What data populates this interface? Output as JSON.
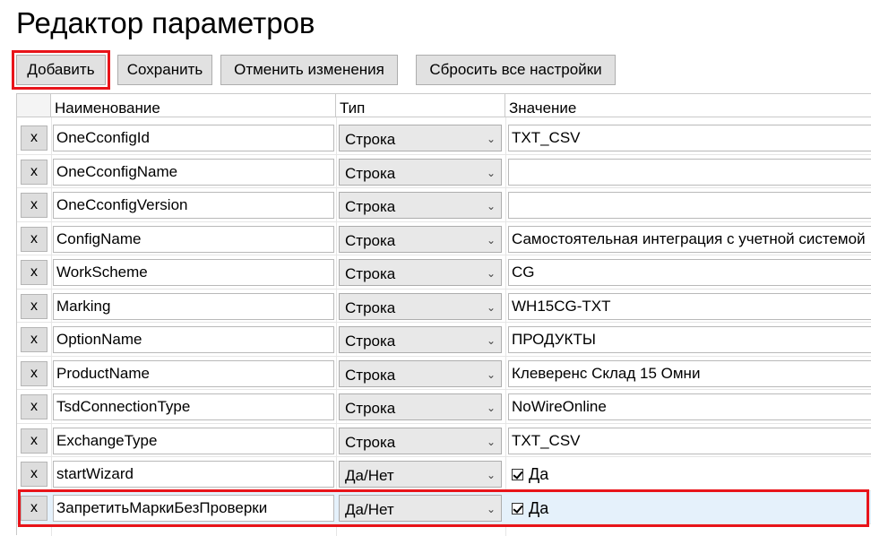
{
  "page": {
    "title": "Редактор параметров"
  },
  "toolbar": {
    "add_label": "Добавить",
    "save_label": "Сохранить",
    "cancel_label": "Отменить изменения",
    "reset_label": "Сбросить все настройки"
  },
  "grid": {
    "columns": [
      "Наименование",
      "Тип",
      "Значение"
    ],
    "delete_label": "x",
    "rows": [
      {
        "name": "OneCconfigId",
        "type": "Строка",
        "value": "TXT_CSV"
      },
      {
        "name": "OneCconfigName",
        "type": "Строка",
        "value": ""
      },
      {
        "name": "OneCconfigVersion",
        "type": "Строка",
        "value": ""
      },
      {
        "name": "ConfigName",
        "type": "Строка",
        "value": "Самостоятельная интеграция с учетной системой"
      },
      {
        "name": "WorkScheme",
        "type": "Строка",
        "value": "CG"
      },
      {
        "name": "Marking",
        "type": "Строка",
        "value": "WH15CG-TXT"
      },
      {
        "name": "OptionName",
        "type": "Строка",
        "value": "ПРОДУКТЫ"
      },
      {
        "name": "ProductName",
        "type": "Строка",
        "value": "Клеверенс Склад 15 Омни"
      },
      {
        "name": "TsdConnectionType",
        "type": "Строка",
        "value": "NoWireOnline"
      },
      {
        "name": "ExchangeType",
        "type": "Строка",
        "value": "TXT_CSV"
      },
      {
        "name": "startWizard",
        "type": "Да/Нет",
        "value": "Да",
        "checked": true
      },
      {
        "name": "ЗапретитьМаркиБезПроверки",
        "type": "Да/Нет",
        "value": "Да",
        "checked": true
      }
    ]
  },
  "colors": {
    "highlight": "#e8141a",
    "selected_row": "#e5f1fb"
  },
  "icons": {
    "dropdown": "chevron-down-icon",
    "checkbox": "checkbox-checked-icon"
  }
}
